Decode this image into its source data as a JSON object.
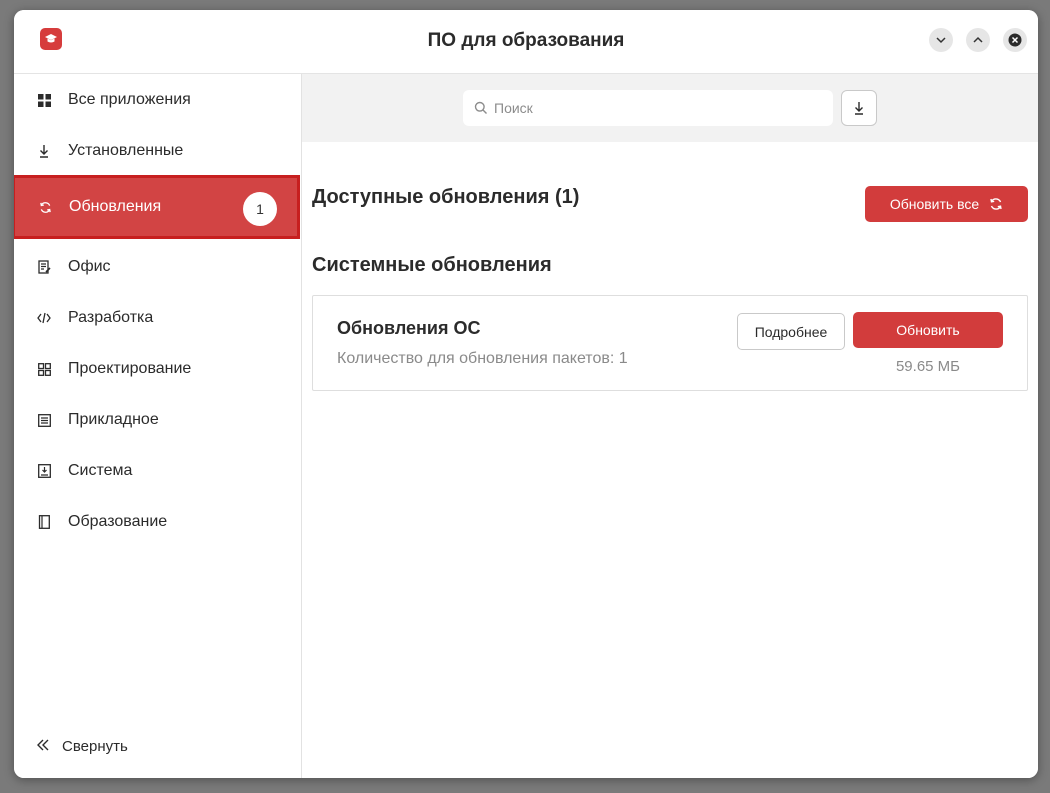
{
  "window": {
    "title": "ПО для образования"
  },
  "sidebar": {
    "items": [
      {
        "label": "Все приложения",
        "icon": "grid-icon"
      },
      {
        "label": "Установленные",
        "icon": "download-icon"
      },
      {
        "label": "Обновления",
        "icon": "refresh-icon",
        "badge": "1",
        "active": true
      },
      {
        "label": "Офис",
        "icon": "document-edit-icon"
      },
      {
        "label": "Разработка",
        "icon": "code-icon"
      },
      {
        "label": "Проектирование",
        "icon": "design-grid-icon"
      },
      {
        "label": "Прикладное",
        "icon": "list-icon"
      },
      {
        "label": "Система",
        "icon": "system-icon"
      },
      {
        "label": "Образование",
        "icon": "book-icon"
      }
    ],
    "collapse_label": "Свернуть"
  },
  "search": {
    "placeholder": "Поиск"
  },
  "main": {
    "available_title": "Доступные обновления (1)",
    "update_all_label": "Обновить все",
    "system_title": "Системные обновления",
    "card": {
      "title": "Обновления ОС",
      "subtitle": "Количество для обновления пакетов: 1",
      "more_label": "Подробнее",
      "update_label": "Обновить",
      "size": "59.65 МБ"
    }
  },
  "colors": {
    "accent": "#d23c3c",
    "active_border": "#c71f1f"
  }
}
